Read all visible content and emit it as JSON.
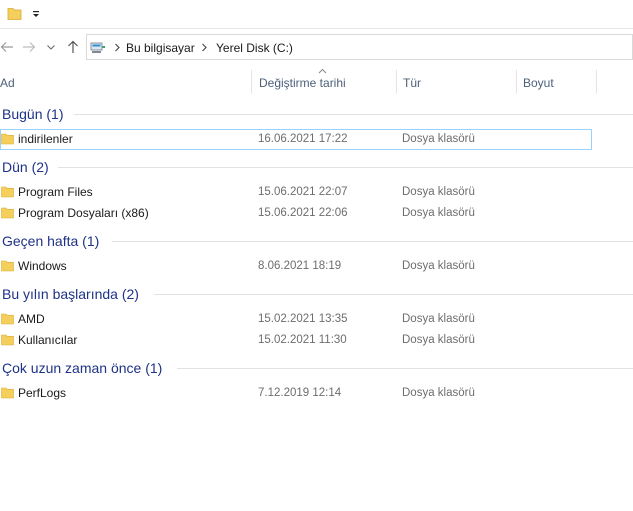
{
  "colors": {
    "group_title": "#1e3287",
    "folder": "#f5cf5c",
    "selection_border": "#99d1ff",
    "column_text": "#4c607a"
  },
  "icons": {
    "quick_access": "folder-icon",
    "dropdown": "chevron-down-icon",
    "back": "arrow-left-icon",
    "forward": "arrow-right-icon",
    "up": "arrow-up-icon",
    "location": "this-pc-icon"
  },
  "address": {
    "crumbs": [
      "Bu bilgisayar",
      "Yerel Disk (C:)"
    ]
  },
  "columns": {
    "name": "Ad",
    "date": "Değiştirme tarihi",
    "type": "Tür",
    "size": "Boyut"
  },
  "groups": [
    {
      "title": "Bugün (1)",
      "items": [
        {
          "name": "indirilenler",
          "date": "16.06.2021 17:22",
          "type": "Dosya klasörü",
          "selected": true
        }
      ]
    },
    {
      "title": "Dün (2)",
      "items": [
        {
          "name": "Program Files",
          "date": "15.06.2021 22:07",
          "type": "Dosya klasörü"
        },
        {
          "name": "Program Dosyaları (x86)",
          "date": "15.06.2021 22:06",
          "type": "Dosya klasörü"
        }
      ]
    },
    {
      "title": "Geçen hafta (1)",
      "items": [
        {
          "name": "Windows",
          "date": "8.06.2021 18:19",
          "type": "Dosya klasörü"
        }
      ]
    },
    {
      "title": "Bu yılın başlarında (2)",
      "items": [
        {
          "name": "AMD",
          "date": "15.02.2021 13:35",
          "type": "Dosya klasörü"
        },
        {
          "name": "Kullanıcılar",
          "date": "15.02.2021 11:30",
          "type": "Dosya klasörü"
        }
      ]
    },
    {
      "title": "Çok uzun zaman önce (1)",
      "items": [
        {
          "name": "PerfLogs",
          "date": "7.12.2019 12:14",
          "type": "Dosya klasörü"
        }
      ]
    }
  ]
}
